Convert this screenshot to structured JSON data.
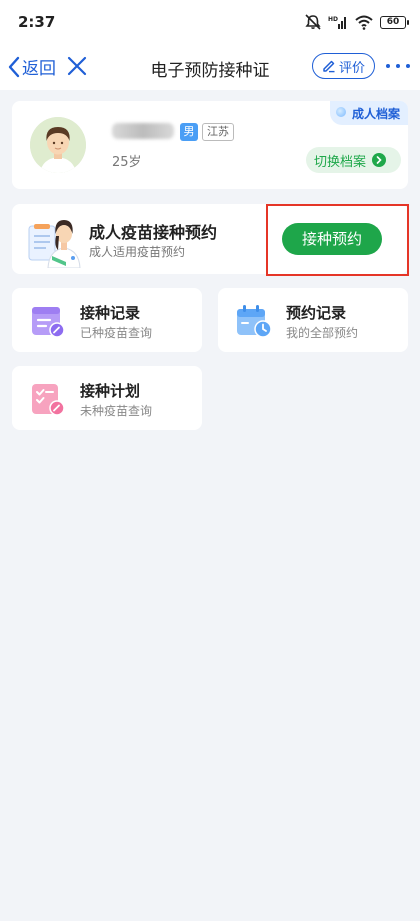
{
  "status_bar": {
    "time": "2:37",
    "battery": "60"
  },
  "nav": {
    "back_label": "返回",
    "title": "电子预防接种证",
    "rate_label": "评价"
  },
  "profile": {
    "archive_tag": "成人档案",
    "gender": "男",
    "region": "江苏",
    "age": "25岁",
    "switch_label": "切换档案"
  },
  "appointment": {
    "title": "成人疫苗接种预约",
    "subtitle": "成人适用疫苗预约",
    "button_label": "接种预约"
  },
  "tiles": [
    {
      "title": "接种记录",
      "subtitle": "已种疫苗查询"
    },
    {
      "title": "预约记录",
      "subtitle": "我的全部预约"
    },
    {
      "title": "接种计划",
      "subtitle": "未种疫苗查询"
    }
  ],
  "colors": {
    "brand_blue": "#1f5fd6",
    "action_green": "#1ea64a",
    "highlight_red": "#e53527",
    "page_bg": "#f2f4f8"
  }
}
